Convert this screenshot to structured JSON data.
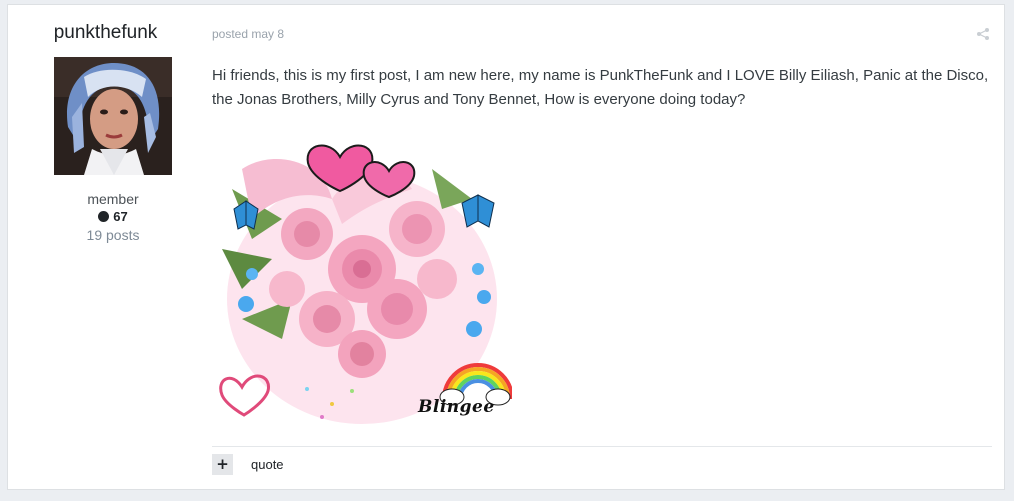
{
  "author": {
    "name": "punkthefunk",
    "member_title": "member",
    "reputation": "67",
    "post_count": "19 posts"
  },
  "post": {
    "meta": "posted may 8",
    "text": "Hi friends, this is my first post, I am new here, my name is PunkTheFunk and I LOVE Billy Eiliash, Panic at the Disco, the Jonas Brothers, Milly Cyrus and Tony Bennet, How is everyone doing today?",
    "image_watermark": "Blingee"
  },
  "actions": {
    "add_label": "+",
    "quote_label": "quote"
  },
  "colors": {
    "background": "#ebeef2",
    "rose": "#f4a6c0",
    "heart": "#f05aa0",
    "butterfly": "#2f8fd6"
  }
}
